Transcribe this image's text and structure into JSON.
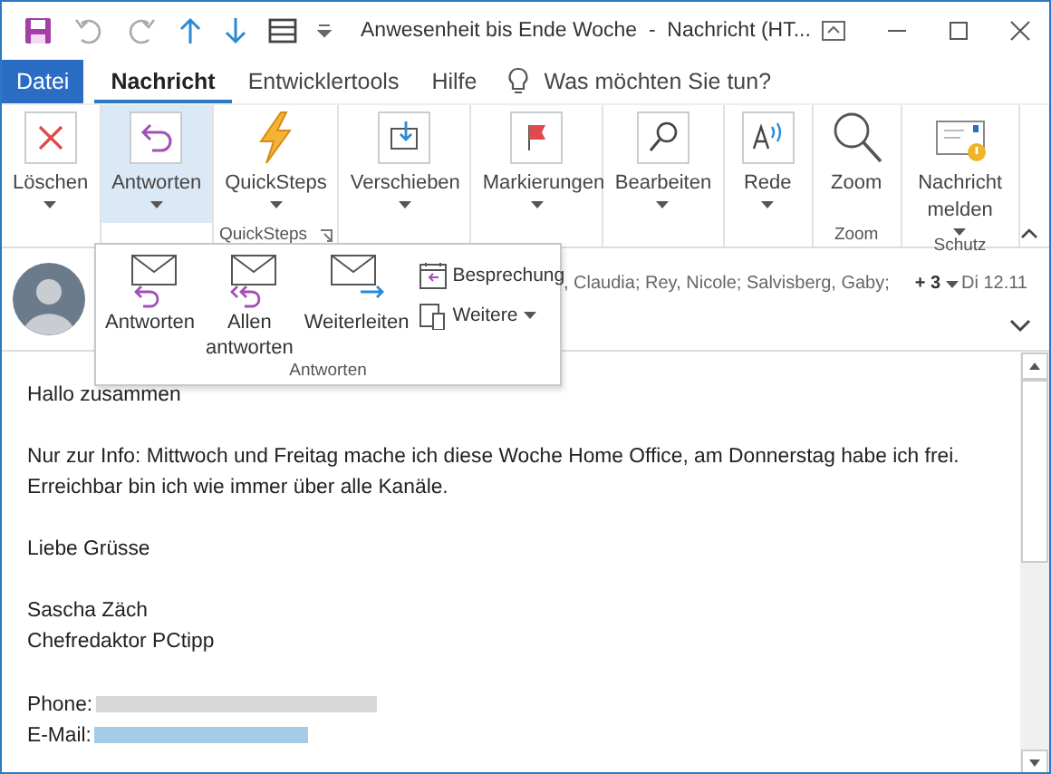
{
  "title_bar": {
    "title": "Anwesenheit bis Ende Woche  -  Nachricht (HT..."
  },
  "tabs": [
    {
      "label": "Datei",
      "kind": "file",
      "selected": false
    },
    {
      "label": "Nachricht",
      "kind": "tab",
      "selected": true
    },
    {
      "label": "Entwicklertools",
      "kind": "tab",
      "selected": false
    },
    {
      "label": "Hilfe",
      "kind": "tab",
      "selected": false
    }
  ],
  "tell_me": {
    "placeholder": "Was möchten Sie tun?"
  },
  "ribbon": {
    "groups": [
      {
        "items": [
          {
            "label": "Löschen",
            "kind": "delete",
            "dropdown": true,
            "selected": false
          }
        ]
      },
      {
        "items": [
          {
            "label": "Antworten",
            "kind": "reply",
            "dropdown": true,
            "selected": true
          }
        ]
      },
      {
        "label": "QuickSteps",
        "launcher": true,
        "items": [
          {
            "label": "QuickSteps",
            "kind": "bolt",
            "dropdown": true,
            "selected": false
          }
        ]
      },
      {
        "items": [
          {
            "label": "Verschieben",
            "kind": "move",
            "dropdown": true,
            "selected": false
          }
        ]
      },
      {
        "items": [
          {
            "label": "Markierungen",
            "kind": "flag",
            "dropdown": true,
            "selected": false
          }
        ]
      },
      {
        "items": [
          {
            "label": "Bearbeiten",
            "kind": "find",
            "dropdown": true,
            "selected": false
          }
        ]
      },
      {
        "items": [
          {
            "label": "Rede",
            "kind": "speech",
            "dropdown": true,
            "selected": false
          }
        ]
      },
      {
        "label": "Zoom",
        "items": [
          {
            "label": "Zoom",
            "kind": "zoom",
            "dropdown": false,
            "selected": false
          }
        ]
      },
      {
        "label": "Schutz",
        "items": [
          {
            "label": "Nachricht melden",
            "kind": "report",
            "dropdown": true,
            "selected": false
          }
        ]
      }
    ]
  },
  "header": {
    "recipients": ", Claudia; Rey, Nicole; Salvisberg, Gaby;",
    "more": "+ 3",
    "date": "Di 12.11"
  },
  "popup": {
    "label": "Antworten",
    "large": [
      {
        "label": "Antworten",
        "kind": "reply"
      },
      {
        "label": "Allen antworten",
        "kind": "replyall"
      },
      {
        "label": "Weiterleiten",
        "kind": "forward"
      }
    ],
    "small": [
      {
        "label": "Besprechung",
        "kind": "meeting",
        "dropdown": false
      },
      {
        "label": "Weitere",
        "kind": "more",
        "dropdown": true
      }
    ]
  },
  "body": {
    "paragraphs": [
      {
        "lines": [
          "Hallo zusammen"
        ]
      },
      {
        "lines": [
          "Nur zur Info: Mittwoch und Freitag mache ich diese Woche Home Office, am Donnerstag habe ich frei.",
          "Erreichbar bin ich wie immer über alle Kanäle."
        ]
      },
      {
        "lines": [
          "Liebe Grüsse"
        ]
      },
      {
        "lines": [
          "Sascha Zäch",
          "Chefredaktor PCtipp"
        ]
      }
    ],
    "contacts": [
      {
        "label": "Phone:",
        "kind": "phone"
      },
      {
        "label": "E-Mail:",
        "kind": "email"
      }
    ]
  }
}
